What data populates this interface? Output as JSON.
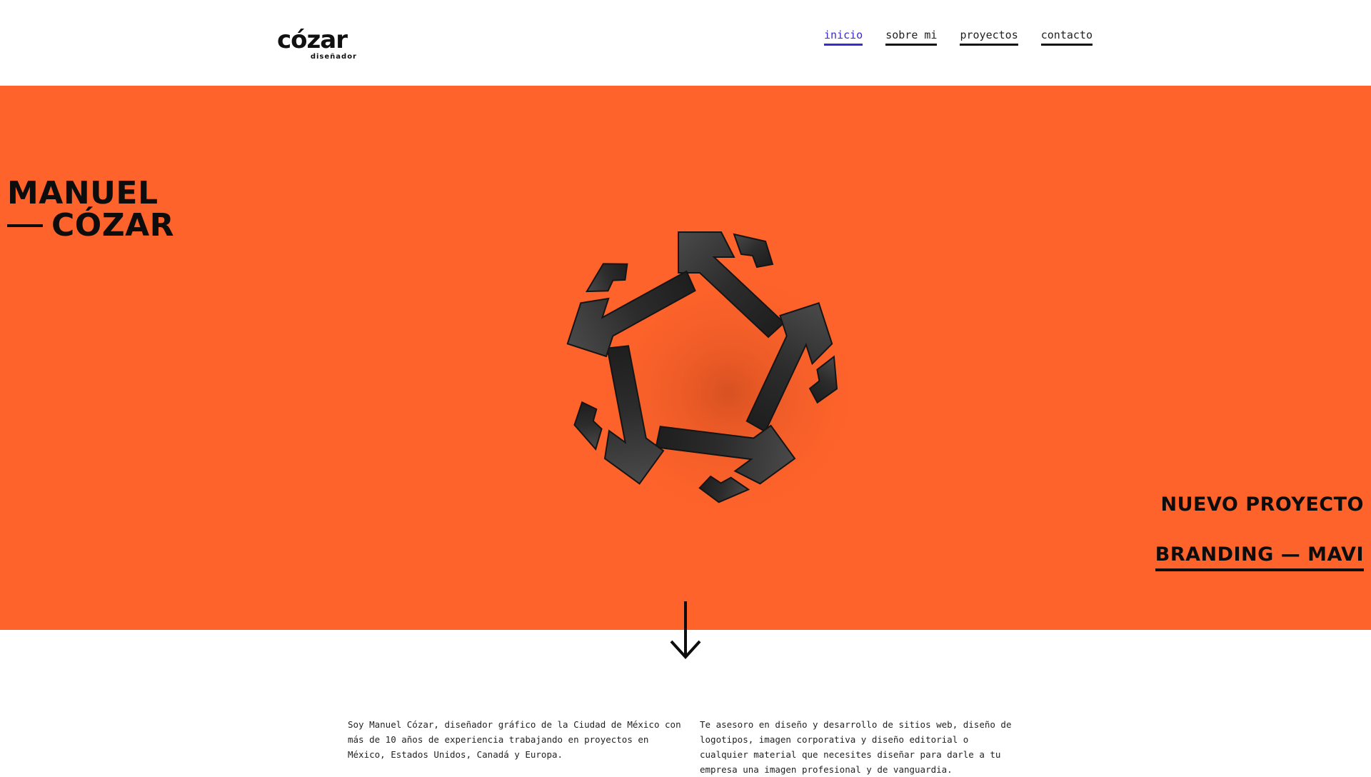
{
  "brand": {
    "name": "cózar",
    "tagline": "diseñador"
  },
  "nav": {
    "items": [
      {
        "label": "inicio",
        "active": true
      },
      {
        "label": "sobre mi",
        "active": false
      },
      {
        "label": "proyectos",
        "active": false
      },
      {
        "label": "contacto",
        "active": false
      }
    ]
  },
  "hero": {
    "title_line1": "MANUEL",
    "title_line2": "CÓZAR",
    "project_kicker": "NUEVO PROYECTO",
    "project_link": "BRANDING — MAVI",
    "background_color": "#fe632b",
    "emblem_icon": "mavi-star-emblem-icon"
  },
  "scroll": {
    "icon": "arrow-down-icon"
  },
  "about": {
    "left_text": "Soy Manuel Cózar, diseñador gráfico de la Ciudad de México con más de 10 años de experiencia trabajando en proyectos en México, Estados Unidos, Canadá y Europa.",
    "right_text": "Te asesoro en diseño y desarrollo de sitios web, diseño de logotipos, imagen corporativa y diseño editorial o cualquier material que necesites diseñar para darle a tu empresa una imagen profesional y de vanguardia."
  },
  "colors": {
    "accent": "#fe632b",
    "nav_active": "#3a2bd1",
    "text": "#111111"
  }
}
